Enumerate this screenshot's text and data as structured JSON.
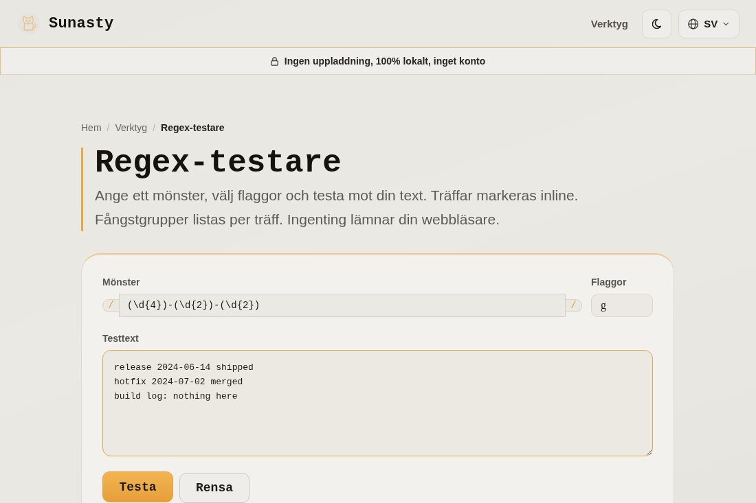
{
  "header": {
    "brand": "Sunasty",
    "nav_link": "Verktyg",
    "language": "SV"
  },
  "banner": {
    "text": "Ingen uppladdning, 100% lokalt, inget konto"
  },
  "breadcrumb": [
    {
      "label": "Hem",
      "current": false
    },
    {
      "separator": "/",
      "label": "Verktyg",
      "current": false
    },
    {
      "separator": "/",
      "label": "Regex-testare",
      "current": true
    }
  ],
  "page": {
    "title": "Regex-testare",
    "description": "Ange ett mönster, välj flaggor och testa mot din text. Träffar markeras inline. Fångstgrupper listas per träff. Ingenting lämnar din webbläsare."
  },
  "form": {
    "pattern": {
      "label": "Mönster",
      "prefix": "/",
      "value": "(\\d{4})-(\\d{2})-(\\d{2})",
      "suffix": "/",
      "focused": false
    },
    "flags": {
      "label": "Flaggor",
      "value": "g",
      "focused": false
    },
    "test_text": {
      "label": "Testtext",
      "value": "release 2024-06-14 shipped\nhotfix 2024-07-02 merged\nbuild log: nothing here",
      "focused": true
    },
    "buttons": [
      {
        "label": "Testa",
        "kind": "primary"
      },
      {
        "label": "Rensa",
        "kind": "secondary"
      }
    ]
  }
}
